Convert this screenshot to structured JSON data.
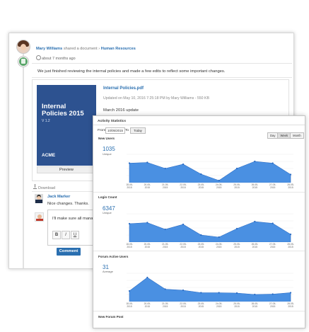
{
  "feed": {
    "author": "Mary Williams",
    "action": "shared a document",
    "target": "Human Resources",
    "time": "about 7 months ago",
    "message": "We just finished reviewing the internal policies and made a few edits to reflect some important changes.",
    "attachment": {
      "cover_title": "Internal Policies 2015",
      "cover_version": "V 1.2",
      "cover_logo": "ACME",
      "file_name": "Internal Policies.pdf",
      "meta": "Updated on May 10, 2016 7:25:18 PM by Mary Williams - 550 KB",
      "description": "March 2016 update",
      "preview_label": "Preview"
    },
    "download_label": "Download",
    "comment": {
      "author": "Jack Marker",
      "text": "Nice changes. Thanks."
    },
    "editor": {
      "text": "I'll make sure all manag",
      "bold": "B",
      "italic": "I",
      "underline": "U"
    },
    "comment_button": "Comment"
  },
  "stats": {
    "title": "Activity Statistics",
    "from_label": "From",
    "from_value": "10/05/2015",
    "to_label": "To",
    "today_label": "Today",
    "range": [
      "Day",
      "Week",
      "Month"
    ],
    "ticks": [
      "18-05-2015",
      "20-05-2015",
      "21-05-2015",
      "22-05-2015",
      "23-05-2015",
      "24-05-2015",
      "25-05-2015",
      "26-05-2015",
      "27-05-2015",
      "28-05-2015"
    ],
    "sections": [
      {
        "title": "New Users",
        "value": "1035",
        "sub": "Unique"
      },
      {
        "title": "Login Count",
        "value": "6347",
        "sub": "Unique"
      },
      {
        "title": "Forum Active Users",
        "value": "31",
        "sub": "Average"
      },
      {
        "title": "New Forum Post",
        "value": "",
        "sub": ""
      }
    ],
    "colors": {
      "area": "#4a90e2",
      "line": "#2b6cc4"
    }
  },
  "chart_data": [
    {
      "type": "area",
      "title": "New Users",
      "x": [
        "18-05-2015",
        "20-05-2015",
        "21-05-2015",
        "22-05-2015",
        "23-05-2015",
        "24-05-2015",
        "25-05-2015",
        "26-05-2015",
        "27-05-2015",
        "28-05-2015"
      ],
      "values": [
        0.55,
        0.57,
        0.4,
        0.52,
        0.24,
        0.06,
        0.4,
        0.6,
        0.55,
        0.23
      ]
    },
    {
      "type": "area",
      "title": "Login Count",
      "x": [
        "18-05-2015",
        "20-05-2015",
        "21-05-2015",
        "22-05-2015",
        "23-05-2015",
        "24-05-2015",
        "25-05-2015",
        "26-05-2015",
        "27-05-2015",
        "28-05-2015"
      ],
      "values": [
        0.52,
        0.55,
        0.36,
        0.5,
        0.2,
        0.14,
        0.38,
        0.58,
        0.53,
        0.22
      ]
    },
    {
      "type": "area",
      "title": "Forum Active Users",
      "x": [
        "18-05-2015",
        "20-05-2015",
        "21-05-2015",
        "22-05-2015",
        "23-05-2015",
        "24-05-2015",
        "25-05-2015",
        "26-05-2015",
        "27-05-2015",
        "28-05-2015"
      ],
      "values": [
        0.3,
        0.68,
        0.35,
        0.32,
        0.25,
        0.25,
        0.24,
        0.2,
        0.21,
        0.25
      ]
    }
  ]
}
